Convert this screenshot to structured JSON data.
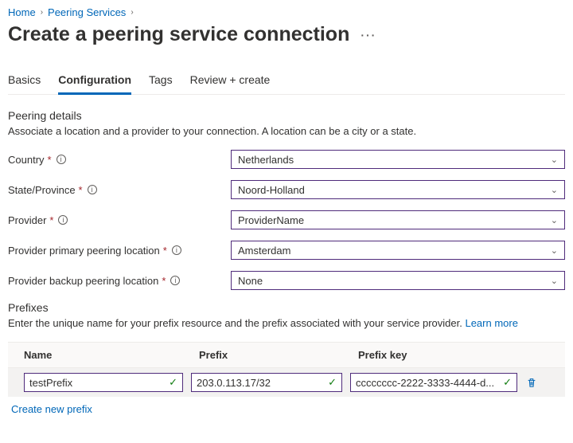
{
  "breadcrumb": {
    "home": "Home",
    "peering": "Peering Services"
  },
  "title": "Create a peering service connection",
  "tabs": {
    "basics": "Basics",
    "config": "Configuration",
    "tags": "Tags",
    "review": "Review + create"
  },
  "peering": {
    "section_title": "Peering details",
    "section_desc": "Associate a location and a provider to your connection. A location can be a city or a state.",
    "country_label": "Country",
    "country_value": "Netherlands",
    "state_label": "State/Province",
    "state_value": "Noord-Holland",
    "provider_label": "Provider",
    "provider_value": "ProviderName",
    "primary_label": "Provider primary peering location",
    "primary_value": "Amsterdam",
    "backup_label": "Provider backup peering location",
    "backup_value": "None"
  },
  "prefixes": {
    "section_title": "Prefixes",
    "section_desc": "Enter the unique name for your prefix resource and the prefix associated with your service provider. ",
    "learn_more": "Learn more",
    "col_name": "Name",
    "col_prefix": "Prefix",
    "col_key": "Prefix key",
    "row": {
      "name": "testPrefix",
      "prefix": "203.0.113.17/32",
      "key": "cccccccc-2222-3333-4444-d..."
    },
    "create_link": "Create new prefix"
  }
}
